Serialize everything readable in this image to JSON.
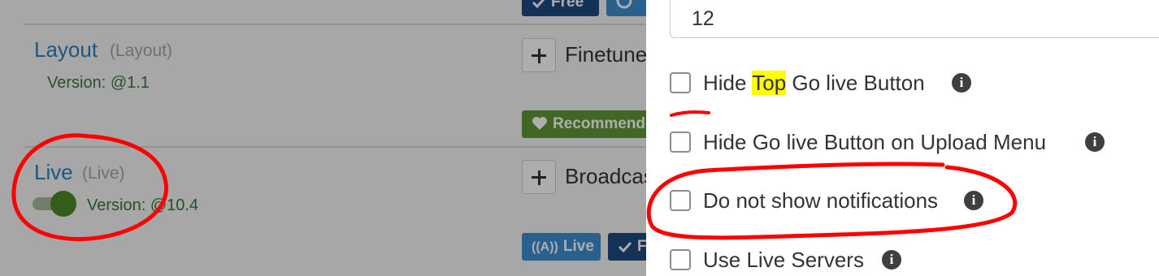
{
  "plugins": [
    {
      "name": "Layout",
      "key": "(Layout)",
      "version": "Version: @1.1",
      "action": "Finetune",
      "tags": [
        {
          "label": "Recommended",
          "icon": "heart-icon",
          "color": "#5f9a36"
        }
      ]
    },
    {
      "name": "Live",
      "key": "(Live)",
      "version": "Version: @10.4",
      "enabled": true,
      "action": "Broadcast",
      "tags": [
        {
          "label": "Live",
          "icon": "broadcast-icon",
          "color": "#3e8ed0"
        },
        {
          "label": "Free",
          "icon": "check-icon",
          "color": "#1e4a80"
        }
      ]
    }
  ],
  "top_tags": [
    {
      "label": "Free",
      "icon": "check-icon",
      "color": "#1e4a80"
    },
    {
      "label": "",
      "icon": "circle-icon",
      "color": "#3e8ed0"
    }
  ],
  "settings": {
    "number_value": "12",
    "options": [
      {
        "id": "hide-top-go-live",
        "prefix": "Hide ",
        "highlight": "Top",
        "suffix": " Go live Button",
        "checked": false,
        "info_icon": "info-icon"
      },
      {
        "id": "hide-go-live-upload",
        "label": "Hide Go live Button on Upload Menu",
        "checked": false,
        "info_icon": "info-icon"
      },
      {
        "id": "do-not-show-notifications",
        "label": "Do not show notifications",
        "checked": false,
        "info_icon": "info-icon"
      },
      {
        "id": "use-live-servers",
        "label": "Use Live Servers",
        "checked": false,
        "info_icon": "info-icon"
      }
    ]
  },
  "colors": {
    "link": "#2a7fc0",
    "version_green": "#3c763d",
    "annotation_red": "#ff0000",
    "highlight": "#ffff00"
  }
}
